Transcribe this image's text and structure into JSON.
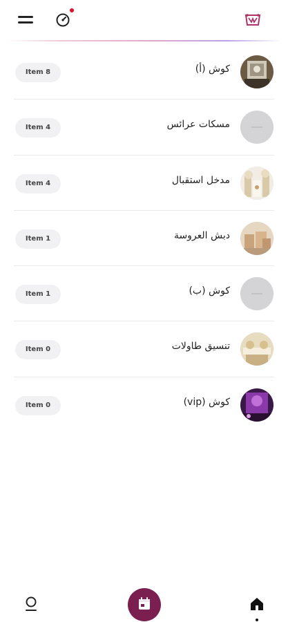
{
  "header": {
    "menu_icon": "hamburger-menu-icon",
    "gauge_icon": "speedometer-icon",
    "notification_dot_color": "#e0102b",
    "logo_icon": "brand-logo-icon",
    "logo_color": "#b0306a"
  },
  "categories": [
    {
      "title": "كوش (أ)",
      "count_label": "Item 8",
      "thumb": "kosha-photo"
    },
    {
      "title": "مسكات عرائس",
      "count_label": "Item 4",
      "thumb": "placeholder"
    },
    {
      "title": "مدخل استقبال",
      "count_label": "Item 4",
      "thumb": "entrance-photo"
    },
    {
      "title": "دبش العروسة",
      "count_label": "Item 1",
      "thumb": "boxes-photo"
    },
    {
      "title": "كوش (ب)",
      "count_label": "Item 1",
      "thumb": "placeholder"
    },
    {
      "title": "تنسيق طاولات",
      "count_label": "Item 0",
      "thumb": "tables-photo"
    },
    {
      "title": "كوش (vip)",
      "count_label": "Item 0",
      "thumb": "vip-photo"
    }
  ],
  "bottom_nav": {
    "profile_icon": "user-profile-icon",
    "center_icon": "calendar-icon",
    "center_color": "#7a1f4f",
    "home_icon": "home-icon",
    "active_tab": "home"
  }
}
